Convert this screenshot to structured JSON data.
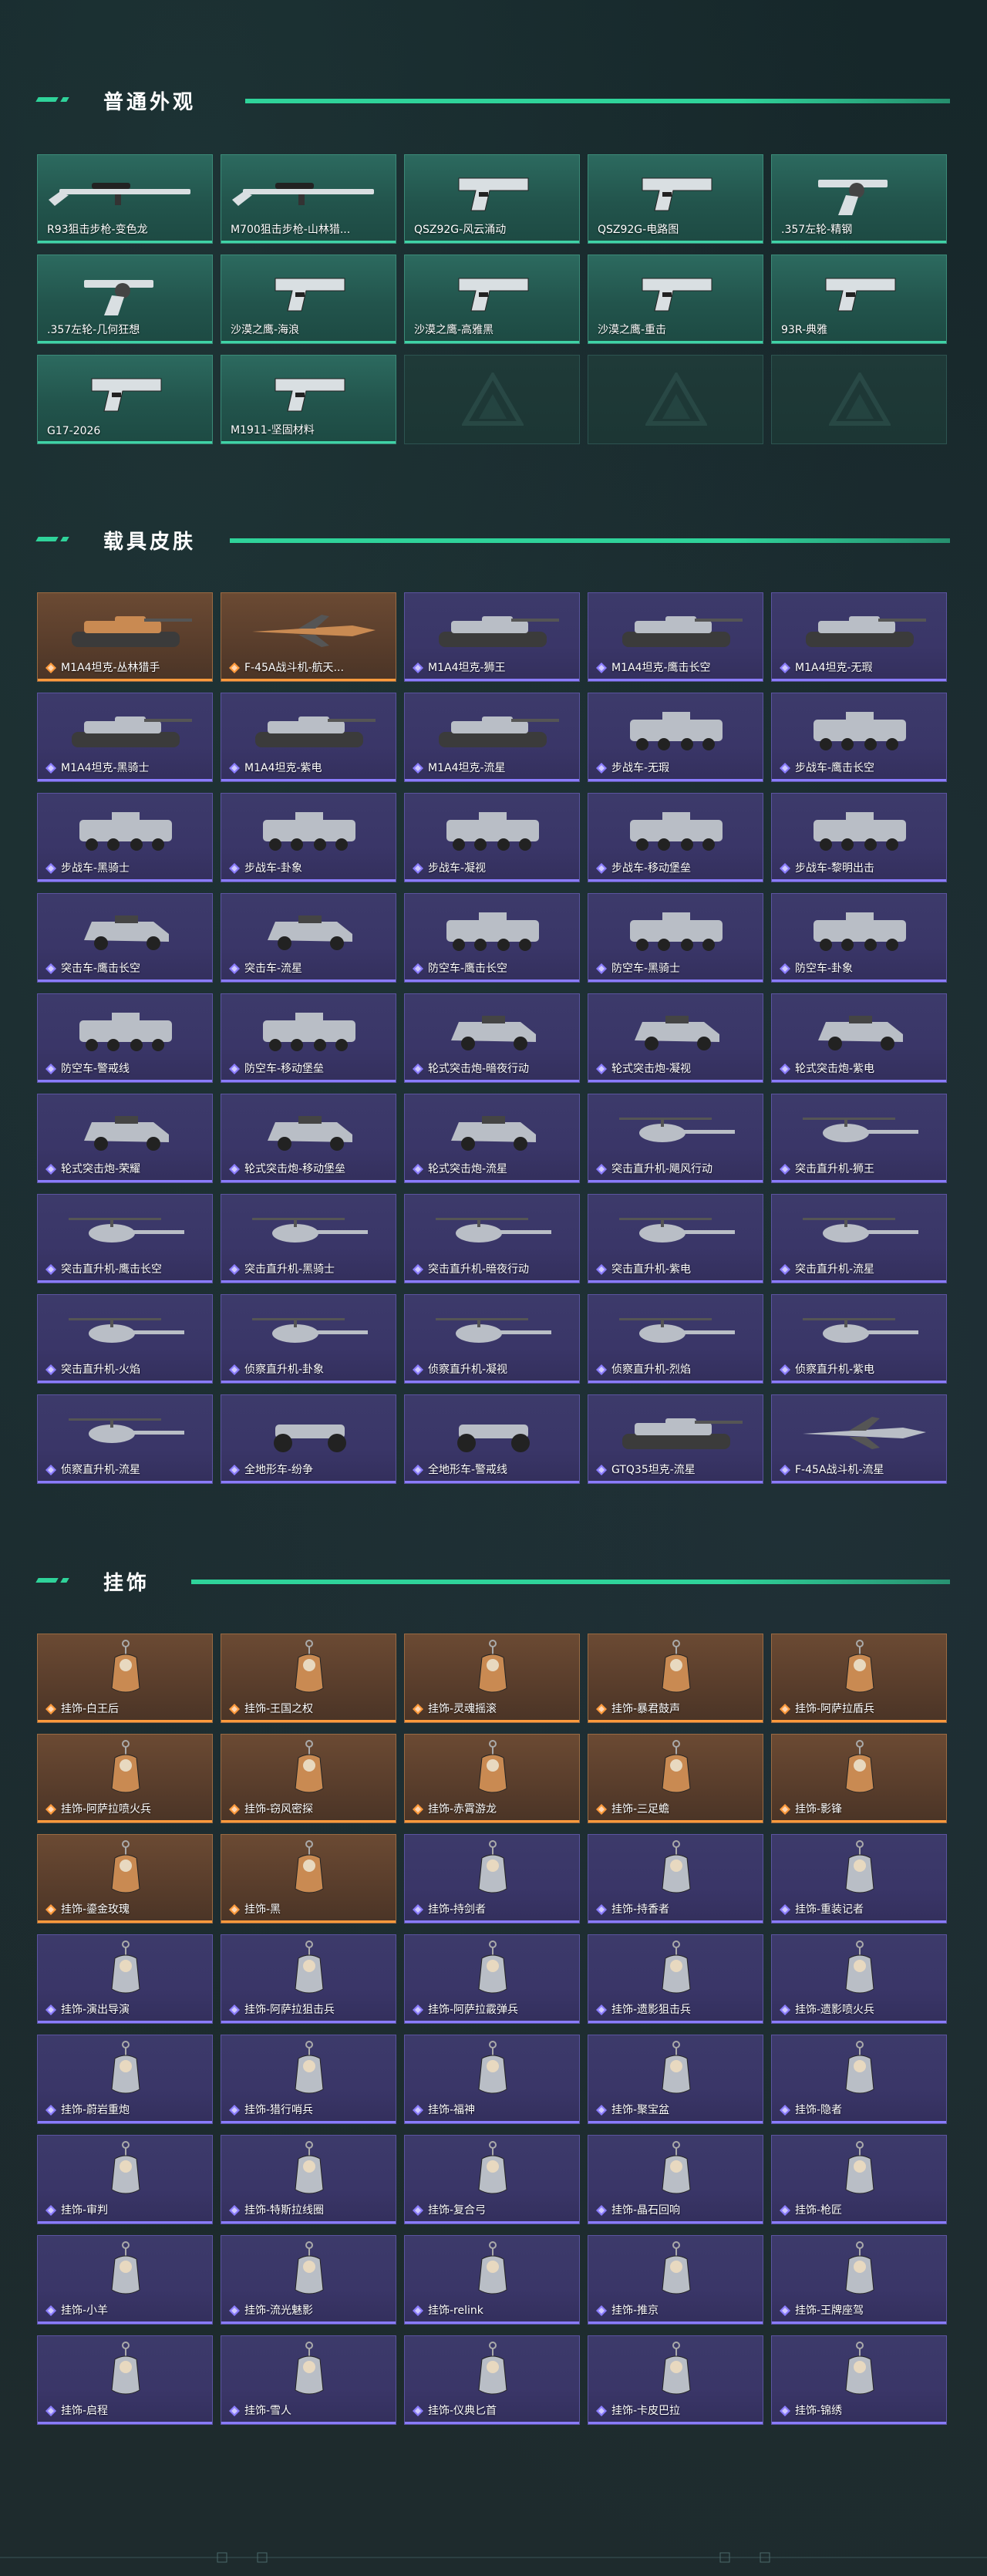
{
  "colors": {
    "accent": "#2fd39a",
    "green_card": "#22544c",
    "purple_card": "#3a3668",
    "orange_card": "#5a3e2c",
    "rarity_purple": "#8a7cff",
    "rarity_orange": "#ff9a3c"
  },
  "sections": [
    {
      "title": "普通外观",
      "items": [
        {
          "label": "R93狙击步枪-变色龙",
          "tier": "green",
          "icon": "sniper-rifle"
        },
        {
          "label": "M700狙击步枪-山林猎...",
          "tier": "green",
          "icon": "sniper-rifle"
        },
        {
          "label": "QSZ92G-风云涌动",
          "tier": "green",
          "icon": "pistol"
        },
        {
          "label": "QSZ92G-电路图",
          "tier": "green",
          "icon": "pistol"
        },
        {
          "label": ".357左轮-精钢",
          "tier": "green",
          "icon": "revolver"
        },
        {
          "label": ".357左轮-几何狂想",
          "tier": "green",
          "icon": "revolver"
        },
        {
          "label": "沙漠之鹰-海浪",
          "tier": "green",
          "icon": "pistol"
        },
        {
          "label": "沙漠之鹰-高雅黑",
          "tier": "green",
          "icon": "pistol"
        },
        {
          "label": "沙漠之鹰-重击",
          "tier": "green",
          "icon": "pistol"
        },
        {
          "label": "93R-典雅",
          "tier": "green",
          "icon": "pistol"
        },
        {
          "label": "G17-2026",
          "tier": "green",
          "icon": "pistol"
        },
        {
          "label": "M1911-坚固材料",
          "tier": "green",
          "icon": "pistol"
        },
        {
          "label": "",
          "tier": "empty",
          "icon": "empty"
        },
        {
          "label": "",
          "tier": "empty",
          "icon": "empty"
        },
        {
          "label": "",
          "tier": "empty",
          "icon": "empty"
        }
      ]
    },
    {
      "title": "载具皮肤",
      "items": [
        {
          "label": "M1A4坦克-丛林猎手",
          "tier": "orange",
          "icon": "tank"
        },
        {
          "label": "F-45A战斗机-航天...",
          "tier": "orange",
          "icon": "jet"
        },
        {
          "label": "M1A4坦克-狮王",
          "tier": "purple",
          "icon": "tank"
        },
        {
          "label": "M1A4坦克-鹰击长空",
          "tier": "purple",
          "icon": "tank"
        },
        {
          "label": "M1A4坦克-无瑕",
          "tier": "purple",
          "icon": "tank"
        },
        {
          "label": "M1A4坦克-黑骑士",
          "tier": "purple",
          "icon": "tank"
        },
        {
          "label": "M1A4坦克-紫电",
          "tier": "purple",
          "icon": "tank"
        },
        {
          "label": "M1A4坦克-流星",
          "tier": "purple",
          "icon": "tank"
        },
        {
          "label": "步战车-无瑕",
          "tier": "purple",
          "icon": "ifv"
        },
        {
          "label": "步战车-鹰击长空",
          "tier": "purple",
          "icon": "ifv"
        },
        {
          "label": "步战车-黑骑士",
          "tier": "purple",
          "icon": "ifv"
        },
        {
          "label": "步战车-卦象",
          "tier": "purple",
          "icon": "ifv"
        },
        {
          "label": "步战车-凝视",
          "tier": "purple",
          "icon": "ifv"
        },
        {
          "label": "步战车-移动堡垒",
          "tier": "purple",
          "icon": "ifv"
        },
        {
          "label": "步战车-黎明出击",
          "tier": "purple",
          "icon": "ifv"
        },
        {
          "label": "突击车-鹰击长空",
          "tier": "purple",
          "icon": "armored-car"
        },
        {
          "label": "突击车-流星",
          "tier": "purple",
          "icon": "armored-car"
        },
        {
          "label": "防空车-鹰击长空",
          "tier": "purple",
          "icon": "ifv"
        },
        {
          "label": "防空车-黑骑士",
          "tier": "purple",
          "icon": "ifv"
        },
        {
          "label": "防空车-卦象",
          "tier": "purple",
          "icon": "ifv"
        },
        {
          "label": "防空车-警戒线",
          "tier": "purple",
          "icon": "ifv"
        },
        {
          "label": "防空车-移动堡垒",
          "tier": "purple",
          "icon": "ifv"
        },
        {
          "label": "轮式突击炮-暗夜行动",
          "tier": "purple",
          "icon": "armored-car"
        },
        {
          "label": "轮式突击炮-凝视",
          "tier": "purple",
          "icon": "armored-car"
        },
        {
          "label": "轮式突击炮-紫电",
          "tier": "purple",
          "icon": "armored-car"
        },
        {
          "label": "轮式突击炮-荣耀",
          "tier": "purple",
          "icon": "armored-car"
        },
        {
          "label": "轮式突击炮-移动堡垒",
          "tier": "purple",
          "icon": "armored-car"
        },
        {
          "label": "轮式突击炮-流星",
          "tier": "purple",
          "icon": "armored-car"
        },
        {
          "label": "突击直升机-飓风行动",
          "tier": "purple",
          "icon": "helicopter"
        },
        {
          "label": "突击直升机-狮王",
          "tier": "purple",
          "icon": "helicopter"
        },
        {
          "label": "突击直升机-鹰击长空",
          "tier": "purple",
          "icon": "helicopter"
        },
        {
          "label": "突击直升机-黑骑士",
          "tier": "purple",
          "icon": "helicopter"
        },
        {
          "label": "突击直升机-暗夜行动",
          "tier": "purple",
          "icon": "helicopter"
        },
        {
          "label": "突击直升机-紫电",
          "tier": "purple",
          "icon": "helicopter"
        },
        {
          "label": "突击直升机-流星",
          "tier": "purple",
          "icon": "helicopter"
        },
        {
          "label": "突击直升机-火焰",
          "tier": "purple",
          "icon": "helicopter"
        },
        {
          "label": "侦察直升机-卦象",
          "tier": "purple",
          "icon": "helicopter"
        },
        {
          "label": "侦察直升机-凝视",
          "tier": "purple",
          "icon": "helicopter"
        },
        {
          "label": "侦察直升机-烈焰",
          "tier": "purple",
          "icon": "helicopter"
        },
        {
          "label": "侦察直升机-紫电",
          "tier": "purple",
          "icon": "helicopter"
        },
        {
          "label": "侦察直升机-流星",
          "tier": "purple",
          "icon": "helicopter"
        },
        {
          "label": "全地形车-纷争",
          "tier": "purple",
          "icon": "atv"
        },
        {
          "label": "全地形车-警戒线",
          "tier": "purple",
          "icon": "atv"
        },
        {
          "label": "GTQ35坦克-流星",
          "tier": "purple",
          "icon": "tank"
        },
        {
          "label": "F-45A战斗机-流星",
          "tier": "purple",
          "icon": "jet"
        }
      ]
    },
    {
      "title": "挂饰",
      "items": [
        {
          "label": "挂饰-白王后",
          "tier": "orange",
          "icon": "charm"
        },
        {
          "label": "挂饰-王国之权",
          "tier": "orange",
          "icon": "charm"
        },
        {
          "label": "挂饰-灵魂摇滚",
          "tier": "orange",
          "icon": "charm"
        },
        {
          "label": "挂饰-暴君鼓声",
          "tier": "orange",
          "icon": "charm"
        },
        {
          "label": "挂饰-阿萨拉盾兵",
          "tier": "orange",
          "icon": "charm"
        },
        {
          "label": "挂饰-阿萨拉喷火兵",
          "tier": "orange",
          "icon": "charm"
        },
        {
          "label": "挂饰-窃风密探",
          "tier": "orange",
          "icon": "charm"
        },
        {
          "label": "挂饰-赤霄游龙",
          "tier": "orange",
          "icon": "charm"
        },
        {
          "label": "挂饰-三足蟾",
          "tier": "orange",
          "icon": "charm"
        },
        {
          "label": "挂饰-影锋",
          "tier": "orange",
          "icon": "charm"
        },
        {
          "label": "挂饰-鎏金玫瑰",
          "tier": "orange",
          "icon": "charm"
        },
        {
          "label": "挂饰-黑",
          "tier": "orange",
          "icon": "charm"
        },
        {
          "label": "挂饰-持剑者",
          "tier": "purple",
          "icon": "charm"
        },
        {
          "label": "挂饰-持香者",
          "tier": "purple",
          "icon": "charm"
        },
        {
          "label": "挂饰-重装记者",
          "tier": "purple",
          "icon": "charm"
        },
        {
          "label": "挂饰-演出导演",
          "tier": "purple",
          "icon": "charm"
        },
        {
          "label": "挂饰-阿萨拉狙击兵",
          "tier": "purple",
          "icon": "charm"
        },
        {
          "label": "挂饰-阿萨拉霰弹兵",
          "tier": "purple",
          "icon": "charm"
        },
        {
          "label": "挂饰-遗影狙击兵",
          "tier": "purple",
          "icon": "charm"
        },
        {
          "label": "挂饰-遗影喷火兵",
          "tier": "purple",
          "icon": "charm"
        },
        {
          "label": "挂饰-蔚岩重炮",
          "tier": "purple",
          "icon": "charm"
        },
        {
          "label": "挂饰-猎行哨兵",
          "tier": "purple",
          "icon": "charm"
        },
        {
          "label": "挂饰-福神",
          "tier": "purple",
          "icon": "charm"
        },
        {
          "label": "挂饰-聚宝盆",
          "tier": "purple",
          "icon": "charm"
        },
        {
          "label": "挂饰-隐者",
          "tier": "purple",
          "icon": "charm"
        },
        {
          "label": "挂饰-审判",
          "tier": "purple",
          "icon": "charm"
        },
        {
          "label": "挂饰-特斯拉线圈",
          "tier": "purple",
          "icon": "charm"
        },
        {
          "label": "挂饰-复合弓",
          "tier": "purple",
          "icon": "charm"
        },
        {
          "label": "挂饰-晶石回响",
          "tier": "purple",
          "icon": "charm"
        },
        {
          "label": "挂饰-枪匠",
          "tier": "purple",
          "icon": "charm"
        },
        {
          "label": "挂饰-小羊",
          "tier": "purple",
          "icon": "charm"
        },
        {
          "label": "挂饰-流光魅影",
          "tier": "purple",
          "icon": "charm"
        },
        {
          "label": "挂饰-relink",
          "tier": "purple",
          "icon": "charm"
        },
        {
          "label": "挂饰-推京",
          "tier": "purple",
          "icon": "charm"
        },
        {
          "label": "挂饰-王牌座驾",
          "tier": "purple",
          "icon": "charm"
        },
        {
          "label": "挂饰-启程",
          "tier": "purple",
          "icon": "charm"
        },
        {
          "label": "挂饰-雪人",
          "tier": "purple",
          "icon": "charm"
        },
        {
          "label": "挂饰-仪典匕首",
          "tier": "purple",
          "icon": "charm"
        },
        {
          "label": "挂饰-卡皮巴拉",
          "tier": "purple",
          "icon": "charm"
        },
        {
          "label": "挂饰-锦绣",
          "tier": "purple",
          "icon": "charm"
        }
      ]
    }
  ]
}
